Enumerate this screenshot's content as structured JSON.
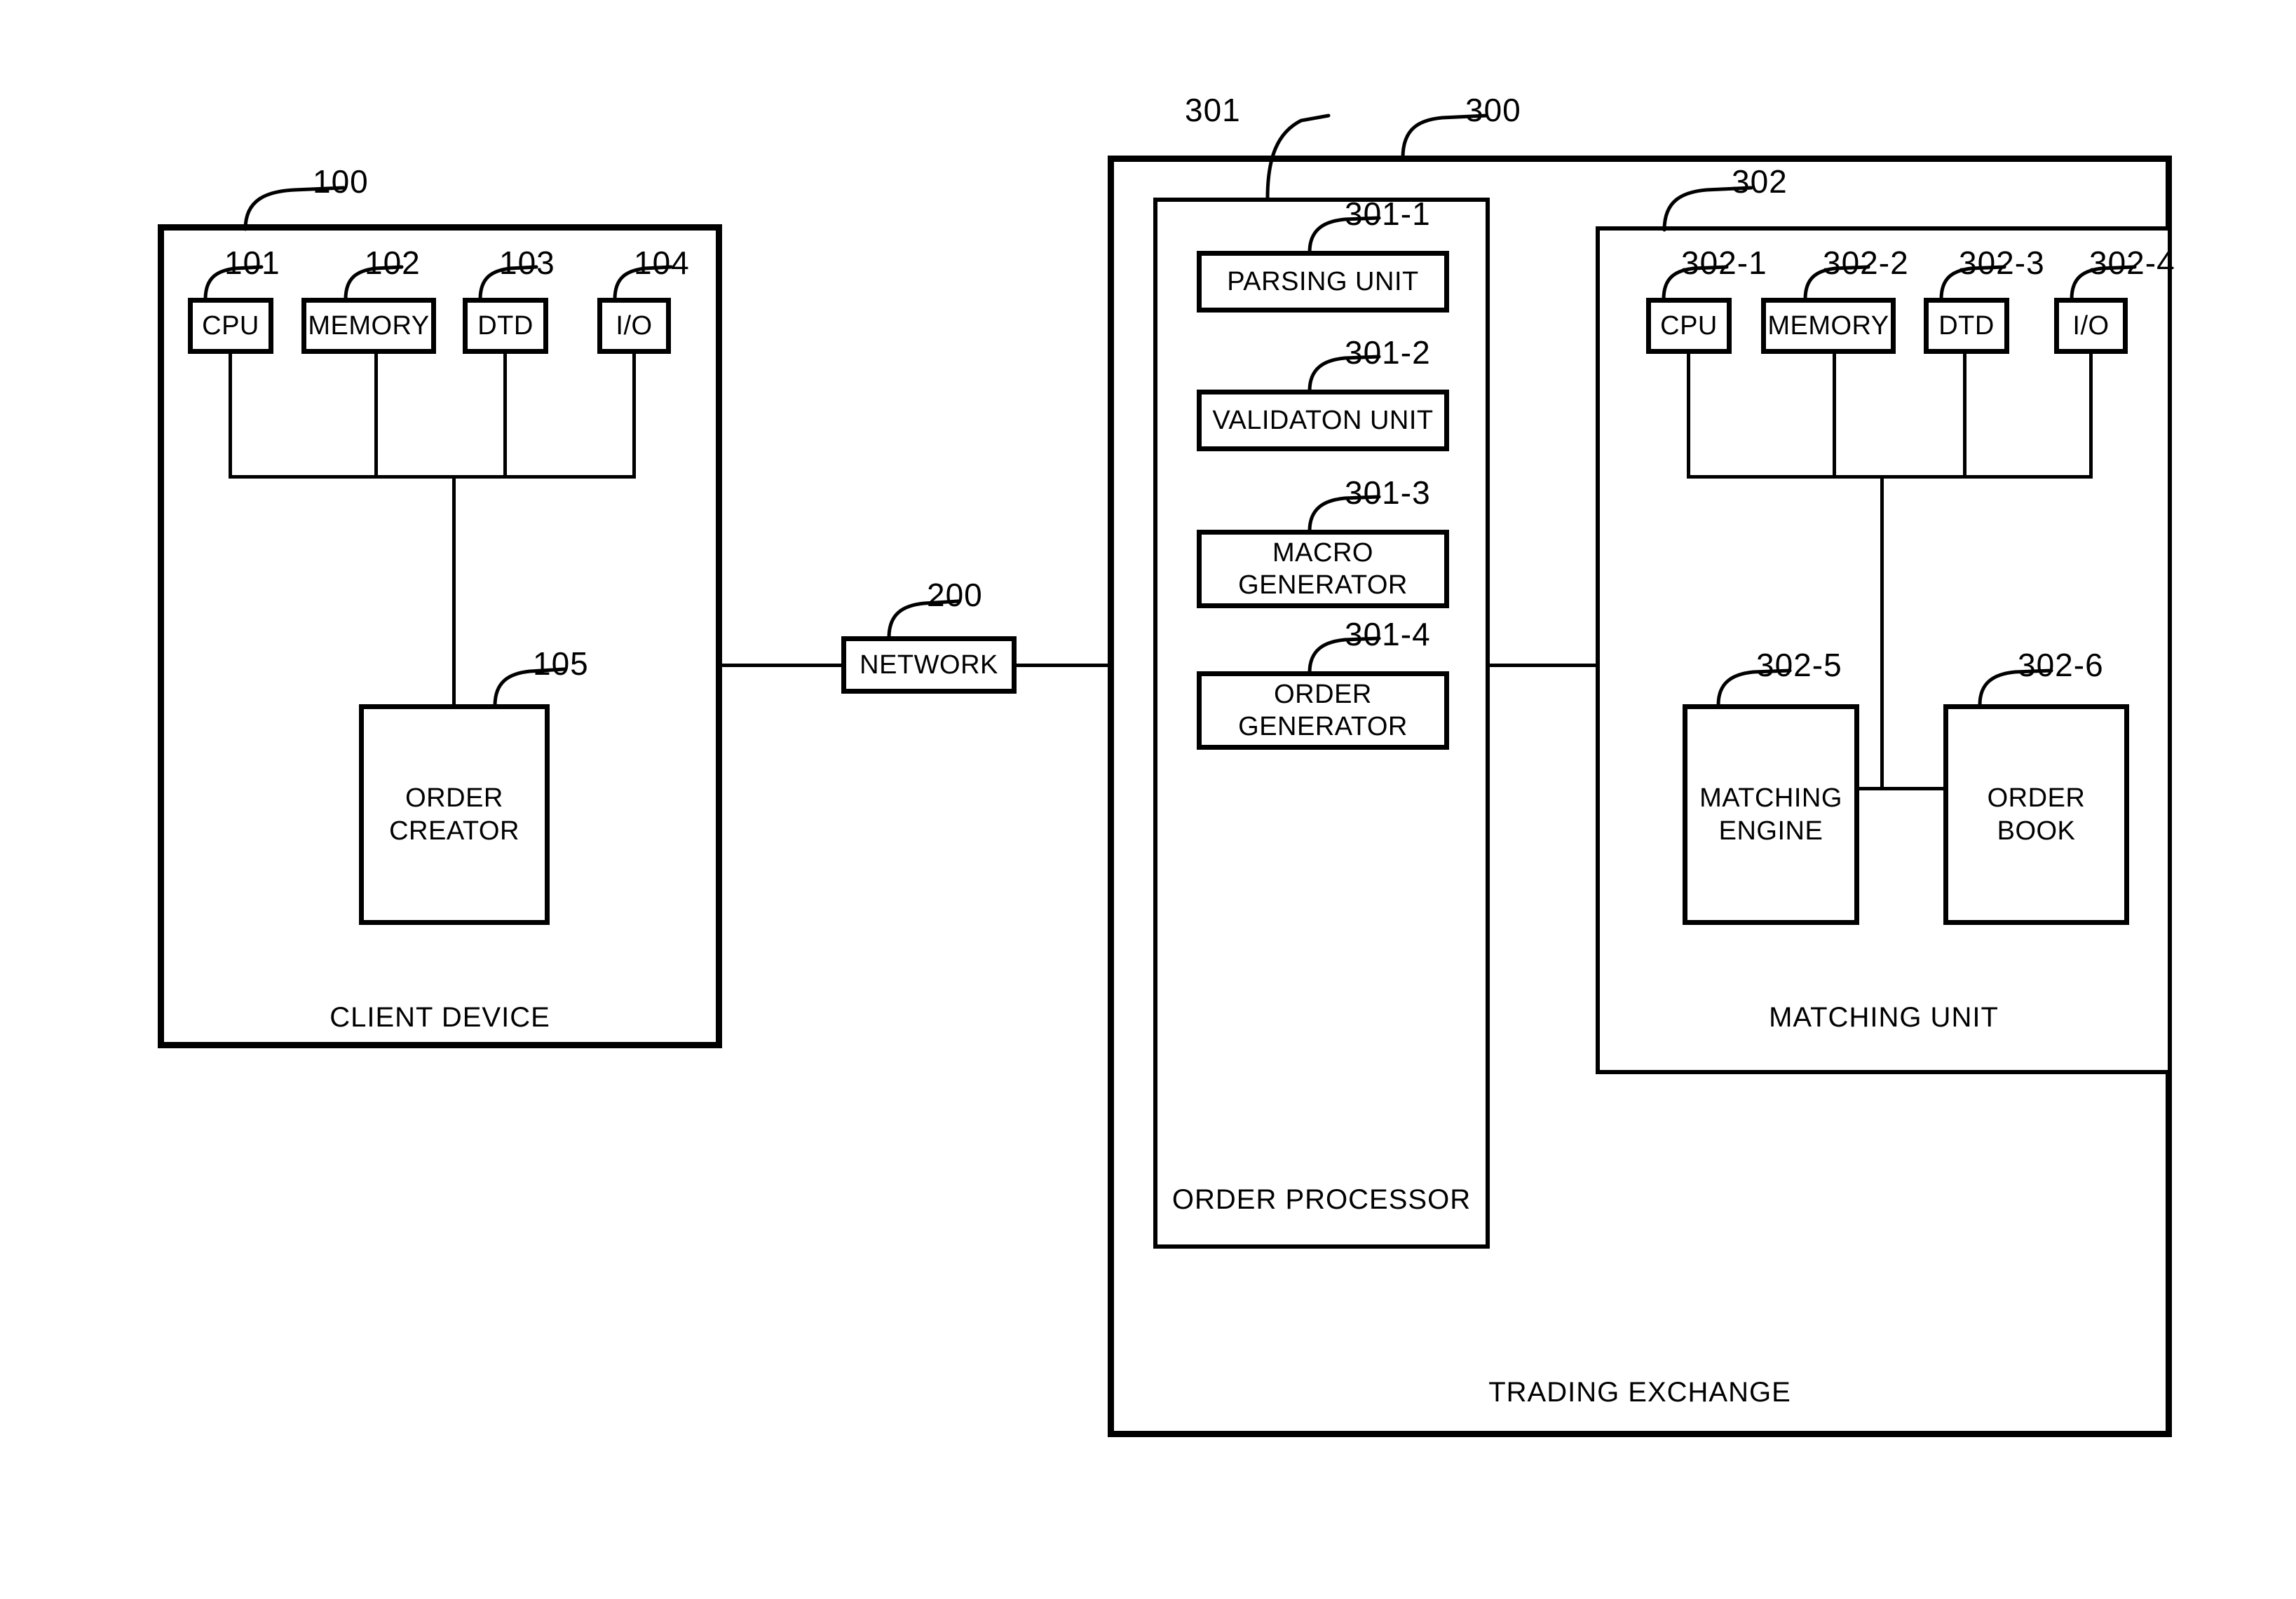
{
  "figure": {
    "type": "patent-block-diagram",
    "background": "#ffffff",
    "stroke_color": "#000000"
  },
  "client_device": {
    "ref": "100",
    "label": "CLIENT DEVICE",
    "components": [
      {
        "ref": "101",
        "label": "CPU"
      },
      {
        "ref": "102",
        "label": "MEMORY"
      },
      {
        "ref": "103",
        "label": "DTD"
      },
      {
        "ref": "104",
        "label": "I/O"
      }
    ],
    "order_creator": {
      "ref": "105",
      "line1": "ORDER",
      "line2": "CREATOR"
    }
  },
  "network": {
    "ref": "200",
    "label": "NETWORK"
  },
  "trading_exchange": {
    "ref": "300",
    "label": "TRADING EXCHANGE"
  },
  "order_processor": {
    "ref": "301",
    "label": "ORDER PROCESSOR",
    "units": [
      {
        "ref": "301-1",
        "line1": "PARSING UNIT",
        "line2": ""
      },
      {
        "ref": "301-2",
        "line1": "VALIDATON UNIT",
        "line2": ""
      },
      {
        "ref": "301-3",
        "line1": "MACRO",
        "line2": "GENERATOR"
      },
      {
        "ref": "301-4",
        "line1": "ORDER",
        "line2": "GENERATOR"
      }
    ]
  },
  "matching_unit": {
    "ref": "302",
    "label": "MATCHING UNIT",
    "components": [
      {
        "ref": "302-1",
        "label": "CPU"
      },
      {
        "ref": "302-2",
        "label": "MEMORY"
      },
      {
        "ref": "302-3",
        "label": "DTD"
      },
      {
        "ref": "302-4",
        "label": "I/O"
      }
    ],
    "matching_engine": {
      "ref": "302-5",
      "line1": "MATCHING",
      "line2": "ENGINE"
    },
    "order_book": {
      "ref": "302-6",
      "line1": "ORDER",
      "line2": "BOOK"
    }
  }
}
